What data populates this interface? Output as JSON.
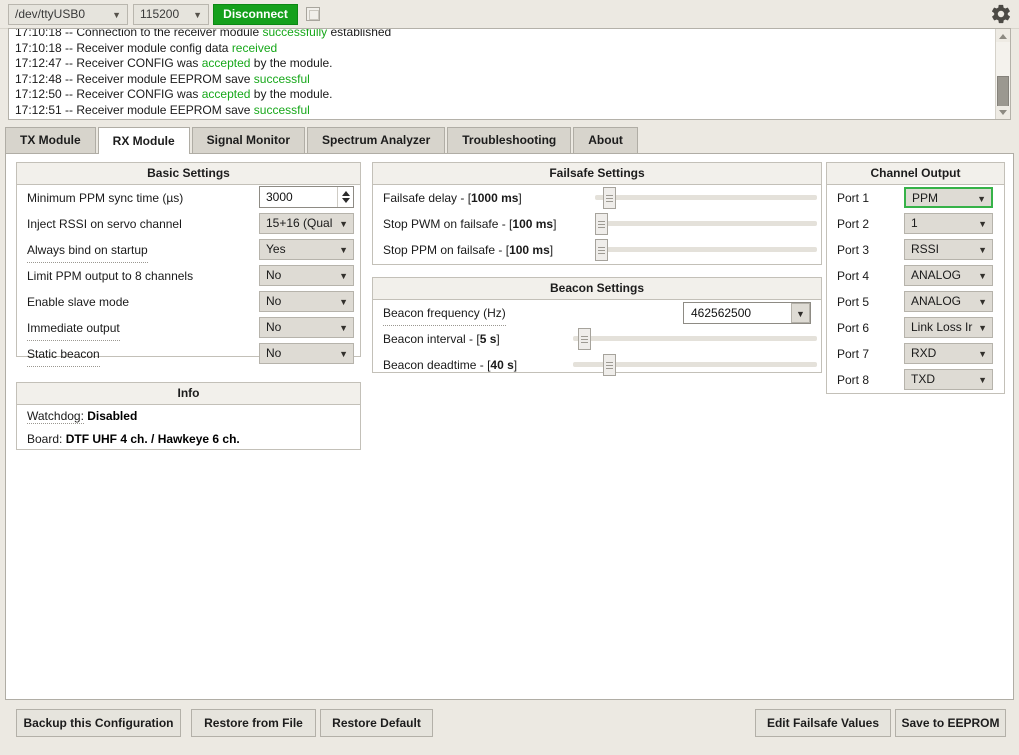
{
  "toolbar": {
    "port": "/dev/ttyUSB0",
    "baud": "115200",
    "disconnect_label": "Disconnect",
    "checkbox_checked": false,
    "gear_icon": "gear-icon"
  },
  "log": {
    "lines": [
      {
        "time": "17:10:18",
        "pre": " -- Connection to the receiver module ",
        "hl": "successfully",
        "post": " established"
      },
      {
        "time": "17:10:18",
        "pre": " -- Receiver module config data ",
        "hl": "received",
        "post": ""
      },
      {
        "time": "17:12:47",
        "pre": " -- Receiver CONFIG was ",
        "hl": "accepted",
        "post": " by the module."
      },
      {
        "time": "17:12:48",
        "pre": " -- Receiver module EEPROM save ",
        "hl": "successful",
        "post": ""
      },
      {
        "time": "17:12:50",
        "pre": " -- Receiver CONFIG was ",
        "hl": "accepted",
        "post": " by the module."
      },
      {
        "time": "17:12:51",
        "pre": " -- Receiver module EEPROM save ",
        "hl": "successful",
        "post": ""
      }
    ]
  },
  "tabs": [
    {
      "label": "TX Module",
      "active": false
    },
    {
      "label": "RX Module",
      "active": true
    },
    {
      "label": "Signal Monitor",
      "active": false
    },
    {
      "label": "Spectrum Analyzer",
      "active": false
    },
    {
      "label": "Troubleshooting",
      "active": false
    },
    {
      "label": "About",
      "active": false
    }
  ],
  "basic_settings": {
    "title": "Basic Settings",
    "rows": [
      {
        "label": "Minimum PPM sync time (µs)",
        "value": "3000",
        "type": "spinner",
        "tooltip": false
      },
      {
        "label": "Inject RSSI on servo channel",
        "value": "15+16 (Qual",
        "type": "combo",
        "tooltip": false
      },
      {
        "label": "Always bind on startup",
        "value": "Yes",
        "type": "combo",
        "tooltip": true
      },
      {
        "label": "Limit PPM output to 8 channels",
        "value": "No",
        "type": "combo",
        "tooltip": false
      },
      {
        "label": "Enable slave mode",
        "value": "No",
        "type": "combo",
        "tooltip": false
      },
      {
        "label": "Immediate output",
        "value": "No",
        "type": "combo",
        "tooltip": true
      },
      {
        "label": "Static beacon",
        "value": "No",
        "type": "combo",
        "tooltip": true
      }
    ]
  },
  "info": {
    "title": "Info",
    "rows": [
      {
        "key": "Watchdog:",
        "value": "Disabled",
        "tooltip": true
      },
      {
        "key": "Board:",
        "value": "DTF UHF 4 ch. / Hawkeye 6 ch.",
        "tooltip": false
      }
    ]
  },
  "failsafe_settings": {
    "title": "Failsafe Settings",
    "rows": [
      {
        "label": "Failsafe delay - [",
        "value": "1000 ms",
        "label_end": "]",
        "percent": 4
      },
      {
        "label": "Stop PWM on failsafe - [",
        "value": "100 ms",
        "label_end": "]",
        "percent": 0
      },
      {
        "label": "Stop PPM on failsafe - [",
        "value": "100 ms",
        "label_end": "]",
        "percent": 0
      }
    ]
  },
  "beacon_settings": {
    "title": "Beacon Settings",
    "frequency_label": "Beacon frequency (Hz)",
    "frequency_value": "462562500",
    "rows": [
      {
        "label": "Beacon interval - [",
        "value": "5 s",
        "label_end": "]",
        "percent": 2
      },
      {
        "label": "Beacon deadtime - [",
        "value": "40 s",
        "label_end": "]",
        "percent": 13
      }
    ]
  },
  "channel_output": {
    "title": "Channel Output",
    "ports": [
      {
        "label": "Port 1",
        "value": "PPM",
        "focused": true
      },
      {
        "label": "Port 2",
        "value": "1",
        "focused": false
      },
      {
        "label": "Port 3",
        "value": "RSSI",
        "focused": false
      },
      {
        "label": "Port 4",
        "value": "ANALOG",
        "focused": false
      },
      {
        "label": "Port 5",
        "value": "ANALOG",
        "focused": false
      },
      {
        "label": "Port 6",
        "value": "Link Loss Ir",
        "focused": false
      },
      {
        "label": "Port 7",
        "value": "RXD",
        "focused": false
      },
      {
        "label": "Port 8",
        "value": "TXD",
        "focused": false
      }
    ]
  },
  "footer": {
    "backup_label": "Backup this Configuration",
    "restore_file_label": "Restore from File",
    "restore_default_label": "Restore Default",
    "edit_failsafe_label": "Edit Failsafe Values",
    "save_eeprom_label": "Save to EEPROM"
  },
  "colors": {
    "accent_green": "#15a01c",
    "log_highlight": "#17a81a",
    "focus_border": "#36b248",
    "window_bg": "#ece9e2",
    "panel_bg": "#ffffff"
  }
}
